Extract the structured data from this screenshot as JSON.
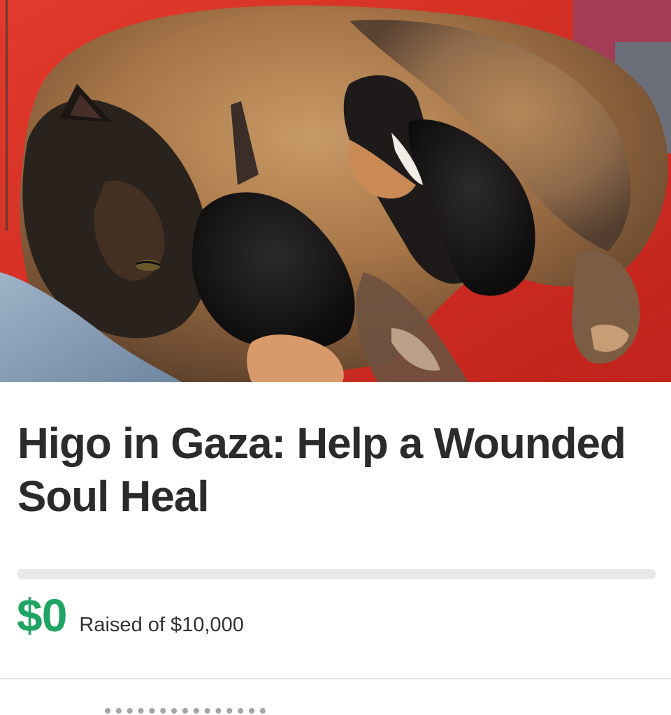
{
  "campaign": {
    "image_alt": "Cat nursing kittens",
    "title": "Higo in Gaza: Help a Wounded Soul Heal",
    "progress": 0,
    "raised_amount": "$0",
    "raised_label": "Raised of $10,000"
  },
  "colors": {
    "accent_green": "#1fa463",
    "title_text": "#2b2b2b",
    "progress_track": "#e8e8e8"
  }
}
